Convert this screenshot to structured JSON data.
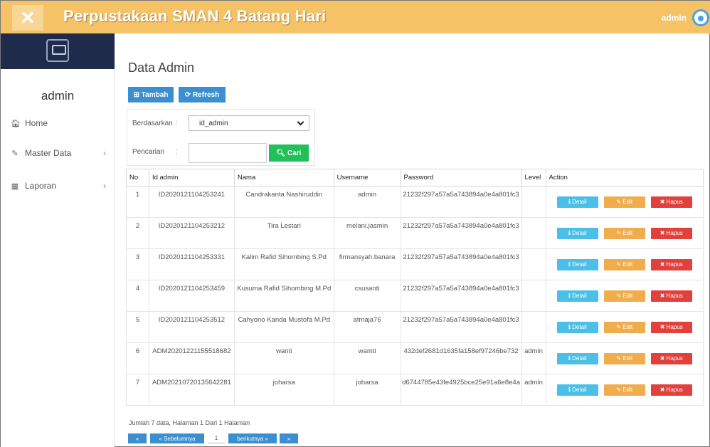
{
  "app": {
    "title": "Perpustakaan SMAN 4 Batang Hari",
    "close_glyph": "✕",
    "user": "admin"
  },
  "sidebar": {
    "user": "admin",
    "items": [
      {
        "icon": "home-icon",
        "glyph": "🏠︎",
        "label": "Home"
      },
      {
        "icon": "edit-icon",
        "glyph": "✎",
        "label": "Master Data",
        "chevron": "›"
      },
      {
        "icon": "calendar-icon",
        "glyph": "▦",
        "label": "Laporan",
        "chevron": "›"
      }
    ]
  },
  "main": {
    "title": "Data Admin",
    "tambah_label": "⊞ Tambah",
    "refresh_label": "⟳ Refresh",
    "filter": {
      "by_label": "Berdasarkan",
      "sep": ":",
      "by_value": "id_admin",
      "search_label": "Pencarian",
      "search_value": "",
      "cari_label": "🔍︎ Cari"
    },
    "table": {
      "headers": [
        "No",
        "Id admin",
        "Nama",
        "Username",
        "Password",
        "Level",
        "Action"
      ],
      "rows": [
        {
          "no": "1",
          "id": "ID2020121104253241",
          "nama": "Candrakanta Nashiruddin",
          "username": "admin",
          "password": "21232f297a57a5a743894a0e4a801fc3",
          "level": ""
        },
        {
          "no": "2",
          "id": "ID2020121104253212",
          "nama": "Tira Lestari",
          "username": "melani.jasmin",
          "password": "21232f297a57a5a743894a0e4a801fc3",
          "level": ""
        },
        {
          "no": "3",
          "id": "ID2020121104253331",
          "nama": "Kalim Rafid Sihombing S.Pd",
          "username": "firmansyah.banara",
          "password": "21232f297a57a5a743894a0e4a801fc3",
          "level": ""
        },
        {
          "no": "4",
          "id": "ID2020121104253459",
          "nama": "Kusuma Rafid Sihombing M.Pd",
          "username": "csusanti",
          "password": "21232f297a57a5a743894a0e4a801fc3",
          "level": ""
        },
        {
          "no": "5",
          "id": "ID2020121104253512",
          "nama": "Cahyono Kanda Mustofa M.Pd",
          "username": "atmaja76",
          "password": "21232f297a57a5a743894a0e4a801fc3",
          "level": ""
        },
        {
          "no": "6",
          "id": "ADM20201221155518682",
          "nama": "wanti",
          "username": "wamti",
          "password": "432def2681d1635fa158ef97246be732",
          "level": "admin"
        },
        {
          "no": "7",
          "id": "ADM20210720135642281",
          "nama": "joharsa",
          "username": "joharsa",
          "password": "d6744785e43fe4925bce25e91a6e8e4a",
          "level": "admin"
        }
      ],
      "action_labels": {
        "detail": "ℹ Detail",
        "edit": "✎ Edit",
        "hapus": "✖ Hapus"
      }
    },
    "summary": "Jumlah 7 data, Halaman 1 Dari 1 Halaman",
    "pager": {
      "first": "«",
      "prev": "« Sebelumnya",
      "page": "1",
      "next": "berikutnya »",
      "last": "»"
    }
  },
  "colors": {
    "topbar": "#f5c265",
    "primary": "#3b8fd0",
    "success": "#22c05a",
    "info": "#4bbfe6",
    "warning": "#f0ad4e",
    "danger": "#e2403b"
  }
}
